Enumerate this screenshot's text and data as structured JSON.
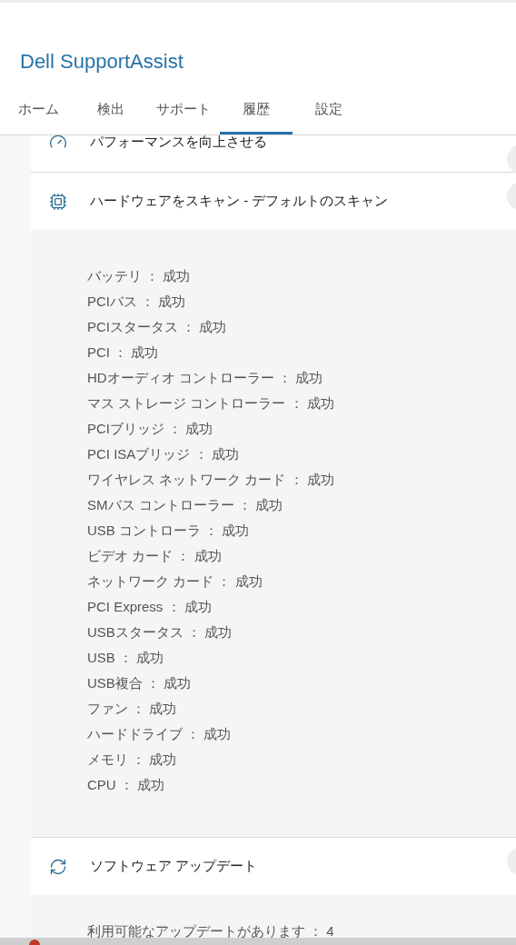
{
  "header": {
    "title": "Dell SupportAssist"
  },
  "tabs": [
    {
      "label": "ホーム",
      "selected": false
    },
    {
      "label": "検出",
      "selected": false
    },
    {
      "label": "サポート",
      "selected": false
    },
    {
      "label": "履歴",
      "selected": true
    },
    {
      "label": "設定",
      "selected": false
    }
  ],
  "sections": [
    {
      "kind": "performance",
      "title": "パフォーマンスを向上させる"
    },
    {
      "kind": "hardware",
      "title": "ハードウェアをスキャン - デフォルトのスキャン",
      "results": [
        {
          "name": "バッテリ",
          "separator": "：",
          "result": "成功"
        },
        {
          "name": "PCIバス",
          "separator": "：",
          "result": "成功"
        },
        {
          "name": "PCIスタータス",
          "separator": "：",
          "result": "成功"
        },
        {
          "name": "PCI",
          "separator": "：",
          "result": "成功"
        },
        {
          "name": "HDオーディオ コントローラー",
          "separator": "：",
          "result": "成功"
        },
        {
          "name": "マス ストレージ コントローラー",
          "separator": "：",
          "result": "成功"
        },
        {
          "name": "PCIブリッジ",
          "separator": "：",
          "result": "成功"
        },
        {
          "name": "PCI ISAブリッジ",
          "separator": "：",
          "result": "成功"
        },
        {
          "name": "ワイヤレス ネットワーク カード",
          "separator": "：",
          "result": "成功"
        },
        {
          "name": "SMバス コントローラー",
          "separator": "：",
          "result": "成功"
        },
        {
          "name": "USB コントローラ",
          "separator": "：",
          "result": "成功"
        },
        {
          "name": "ビデオ カード",
          "separator": "：",
          "result": "成功"
        },
        {
          "name": "ネットワーク カード",
          "separator": "：",
          "result": "成功"
        },
        {
          "name": "PCI Express",
          "separator": "：",
          "result": "成功"
        },
        {
          "name": "USBスタータス",
          "separator": "：",
          "result": "成功"
        },
        {
          "name": "USB",
          "separator": "：",
          "result": "成功"
        },
        {
          "name": "USB複合",
          "separator": "：",
          "result": "成功"
        },
        {
          "name": "ファン",
          "separator": "：",
          "result": "成功"
        },
        {
          "name": "ハードドライブ",
          "separator": "：",
          "result": "成功"
        },
        {
          "name": "メモリ",
          "separator": "：",
          "result": "成功"
        },
        {
          "name": "CPU",
          "separator": "：",
          "result": "成功"
        }
      ]
    },
    {
      "kind": "software",
      "title": "ソフトウェア アップデート",
      "results": [
        {
          "name": "利用可能なアップデートがあります",
          "separator": "：",
          "result": "4"
        }
      ]
    }
  ]
}
